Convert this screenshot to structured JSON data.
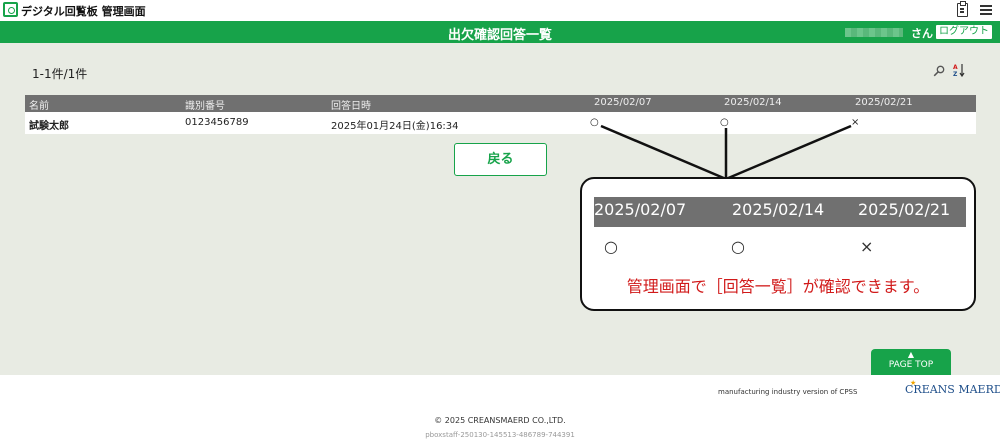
{
  "app": {
    "title": "デジタル回覧板 管理画面"
  },
  "header": {
    "page_title": "出欠確認回答一覧",
    "user_suffix": "さん",
    "logout_label": "ログアウト"
  },
  "list": {
    "count": "1-1件/1件",
    "columns": [
      "名前",
      "識別番号",
      "回答日時",
      "2025/02/07",
      "2025/02/14",
      "2025/02/21"
    ],
    "rows": [
      {
        "name": "試験太郎",
        "id": "0123456789",
        "answered_at": "2025年01月24日(金)16:34",
        "answers": [
          "○",
          "○",
          "×"
        ]
      }
    ]
  },
  "back_label": "戻る",
  "callout": {
    "dates": [
      "2025/02/07",
      "2025/02/14",
      "2025/02/21"
    ],
    "answers": [
      "○",
      "○",
      "×"
    ],
    "note": "管理画面で［回答一覧］が確認できます。"
  },
  "page_top_label": "PAGE TOP",
  "footer": {
    "tagline": "manufacturing industry version of CPSS",
    "brand": "CREANS MAERD",
    "copyright": "© 2025 CREANSMAERD CO.,LTD.",
    "id": "pboxstaff-250130-145513-486789-744391"
  },
  "colors": {
    "brand_green": "#17a34a",
    "header_gray": "#707070",
    "content_bg": "#e8ebe3",
    "note_red": "#d11a1a"
  }
}
